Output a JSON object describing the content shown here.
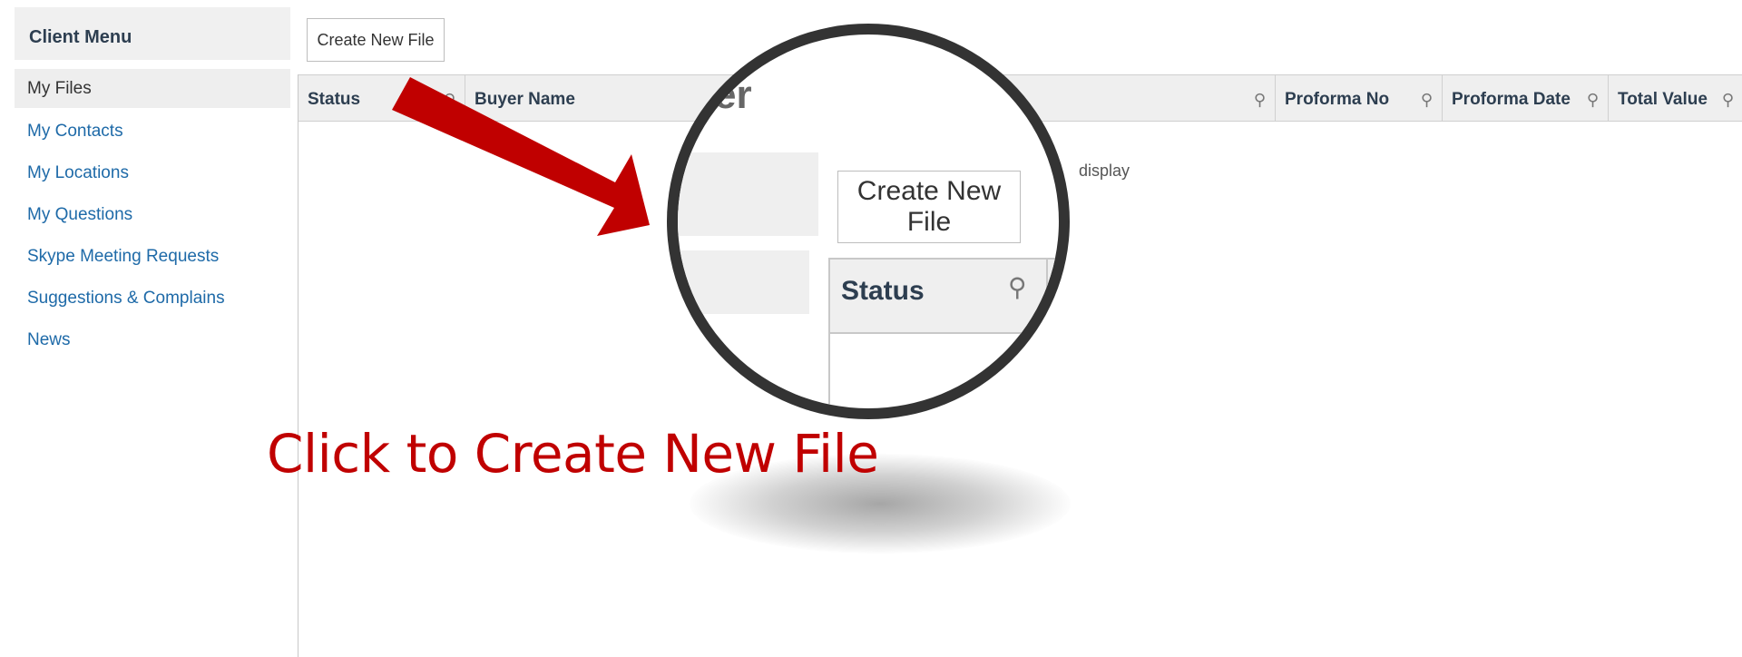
{
  "sidebar": {
    "title": "Client Menu",
    "items": [
      {
        "label": "My Files",
        "active": true
      },
      {
        "label": "My Contacts"
      },
      {
        "label": "My Locations"
      },
      {
        "label": "My Questions"
      },
      {
        "label": "Skype Meeting Requests"
      },
      {
        "label": "Suggestions & Complains"
      },
      {
        "label": "News"
      }
    ]
  },
  "toolbar": {
    "create_label": "Create New File"
  },
  "grid": {
    "columns": [
      "Status",
      "Buyer Name",
      "Proforma No",
      "Proforma Date",
      "Total Value"
    ],
    "empty_fragment": "display",
    "pin_icon": "pin-icon"
  },
  "magnifier": {
    "create_label": "Create New File",
    "status_label": "Status",
    "cut_letters": "er"
  },
  "annotation": {
    "caption": "Click to Create New File"
  },
  "colors": {
    "accent_red": "#c00000",
    "link_blue": "#1e6aa8",
    "header_gray": "#efefef"
  }
}
